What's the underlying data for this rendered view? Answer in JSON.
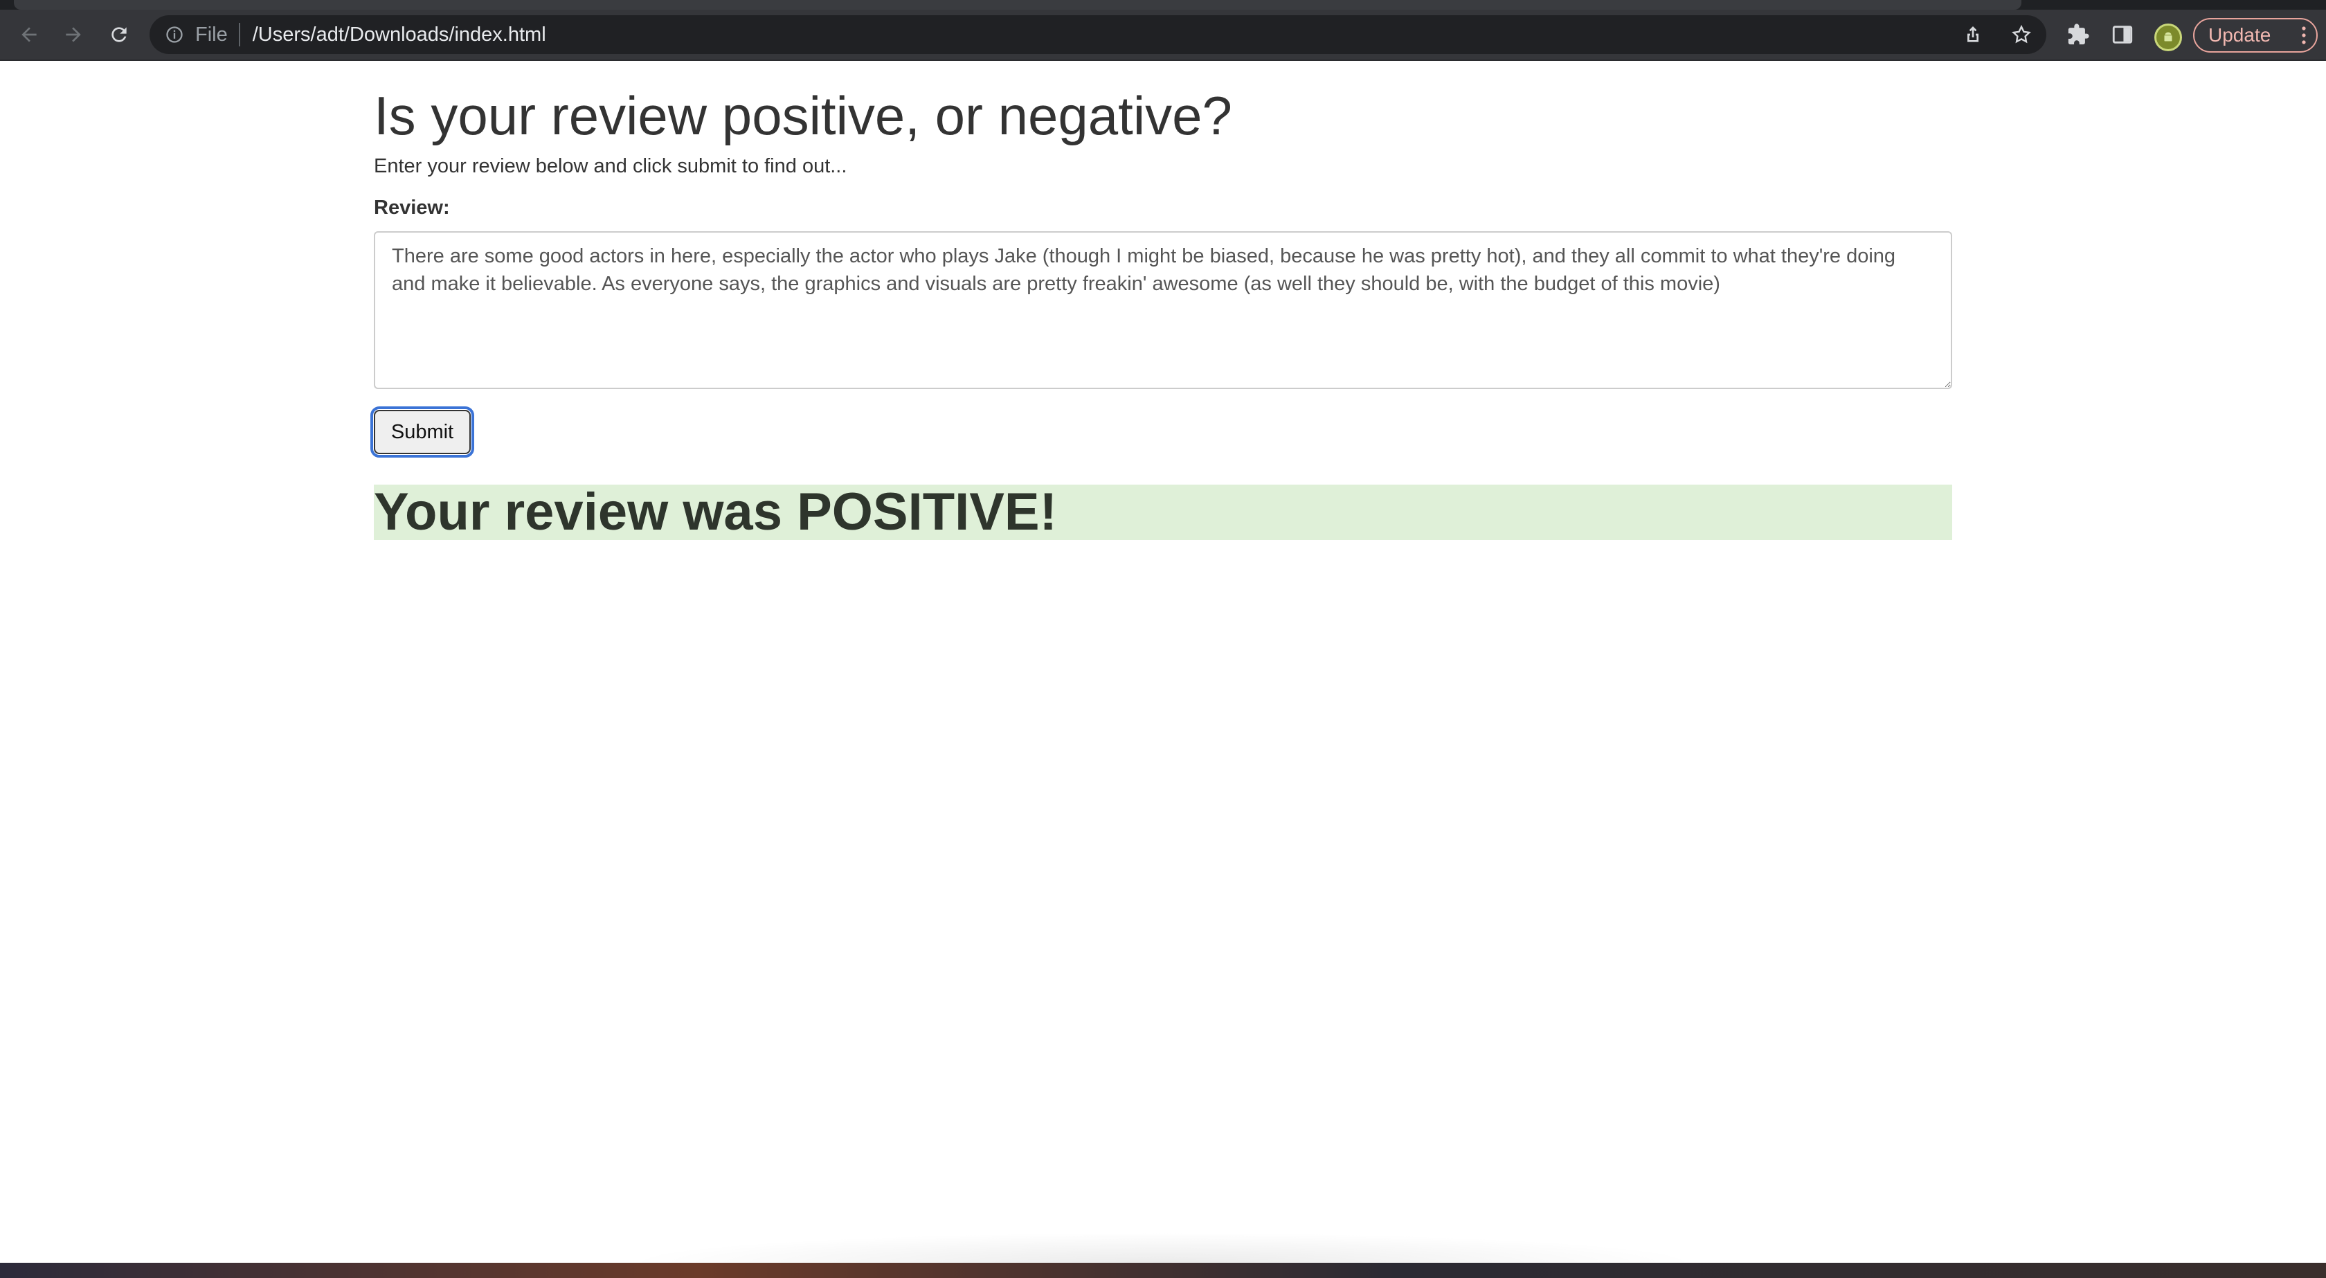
{
  "browser": {
    "omnibox": {
      "scheme_label": "File",
      "url": "/Users/adt/Downloads/index.html"
    },
    "update_label": "Update"
  },
  "page": {
    "title": "Is your review positive, or negative?",
    "intro": "Enter your review below and click submit to find out...",
    "review_label": "Review:",
    "review_text": "There are some good actors in here, especially the actor who plays Jake (though I might be biased, because he was pretty hot), and they all commit to what they're doing and make it believable. As everyone says, the graphics and visuals are pretty freakin' awesome (as well they should be, with the budget of this movie)",
    "submit_label": "Submit",
    "result_text": "Your review was POSITIVE!",
    "result_bg_color": "#dff0d8"
  }
}
